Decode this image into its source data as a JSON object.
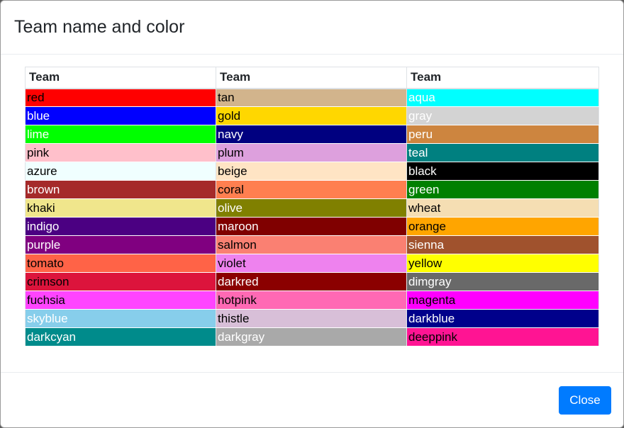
{
  "dialog": {
    "title": "Team name and color",
    "close_label": "Close"
  },
  "table": {
    "headers": [
      "Team",
      "Team",
      "Team"
    ],
    "rows": [
      [
        {
          "name": "red",
          "bg": "#ff0000",
          "fg": "#000000"
        },
        {
          "name": "tan",
          "bg": "#d2b48c",
          "fg": "#000000"
        },
        {
          "name": "aqua",
          "bg": "#00ffff",
          "fg": "#ffffff"
        }
      ],
      [
        {
          "name": "blue",
          "bg": "#0000ff",
          "fg": "#ffffff"
        },
        {
          "name": "gold",
          "bg": "#ffd700",
          "fg": "#000000"
        },
        {
          "name": "gray",
          "bg": "#d3d3d3",
          "fg": "#ffffff"
        }
      ],
      [
        {
          "name": "lime",
          "bg": "#00ff00",
          "fg": "#ffffff"
        },
        {
          "name": "navy",
          "bg": "#000080",
          "fg": "#ffffff"
        },
        {
          "name": "peru",
          "bg": "#cd853f",
          "fg": "#ffffff"
        }
      ],
      [
        {
          "name": "pink",
          "bg": "#ffc0cb",
          "fg": "#000000"
        },
        {
          "name": "plum",
          "bg": "#dda0dd",
          "fg": "#000000"
        },
        {
          "name": "teal",
          "bg": "#008080",
          "fg": "#ffffff"
        }
      ],
      [
        {
          "name": "azure",
          "bg": "#f0ffff",
          "fg": "#000000"
        },
        {
          "name": "beige",
          "bg": "#ffe4c4",
          "fg": "#000000"
        },
        {
          "name": "black",
          "bg": "#000000",
          "fg": "#ffffff"
        }
      ],
      [
        {
          "name": "brown",
          "bg": "#a52a2a",
          "fg": "#ffffff"
        },
        {
          "name": "coral",
          "bg": "#ff7f50",
          "fg": "#000000"
        },
        {
          "name": "green",
          "bg": "#008000",
          "fg": "#ffffff"
        }
      ],
      [
        {
          "name": "khaki",
          "bg": "#f0e68c",
          "fg": "#000000"
        },
        {
          "name": "olive",
          "bg": "#808000",
          "fg": "#ffffff"
        },
        {
          "name": "wheat",
          "bg": "#f5deb3",
          "fg": "#000000"
        }
      ],
      [
        {
          "name": "indigo",
          "bg": "#4b0082",
          "fg": "#ffffff"
        },
        {
          "name": "maroon",
          "bg": "#800000",
          "fg": "#ffffff"
        },
        {
          "name": "orange",
          "bg": "#ffa500",
          "fg": "#000000"
        }
      ],
      [
        {
          "name": "purple",
          "bg": "#800080",
          "fg": "#ffffff"
        },
        {
          "name": "salmon",
          "bg": "#fa8072",
          "fg": "#000000"
        },
        {
          "name": "sienna",
          "bg": "#a0522d",
          "fg": "#ffffff"
        }
      ],
      [
        {
          "name": "tomato",
          "bg": "#ff6347",
          "fg": "#000000"
        },
        {
          "name": "violet",
          "bg": "#ee82ee",
          "fg": "#000000"
        },
        {
          "name": "yellow",
          "bg": "#ffff00",
          "fg": "#000000"
        }
      ],
      [
        {
          "name": "crimson",
          "bg": "#dc143c",
          "fg": "#000000"
        },
        {
          "name": "darkred",
          "bg": "#8b0000",
          "fg": "#ffffff"
        },
        {
          "name": "dimgray",
          "bg": "#696969",
          "fg": "#ffffff"
        }
      ],
      [
        {
          "name": "fuchsia",
          "bg": "#ff44ff",
          "fg": "#000000"
        },
        {
          "name": "hotpink",
          "bg": "#ff69b4",
          "fg": "#000000"
        },
        {
          "name": "magenta",
          "bg": "#ff00ff",
          "fg": "#000000"
        }
      ],
      [
        {
          "name": "skyblue",
          "bg": "#87ceeb",
          "fg": "#ffffff"
        },
        {
          "name": "thistle",
          "bg": "#d8bfd8",
          "fg": "#000000"
        },
        {
          "name": "darkblue",
          "bg": "#00008b",
          "fg": "#ffffff"
        }
      ],
      [
        {
          "name": "darkcyan",
          "bg": "#008b8b",
          "fg": "#ffffff"
        },
        {
          "name": "darkgray",
          "bg": "#a9a9a9",
          "fg": "#ffffff"
        },
        {
          "name": "deeppink",
          "bg": "#ff1493",
          "fg": "#000000"
        }
      ]
    ]
  },
  "colors": {
    "primary": "#007bff",
    "border": "#dee2e6",
    "text": "#212529"
  }
}
